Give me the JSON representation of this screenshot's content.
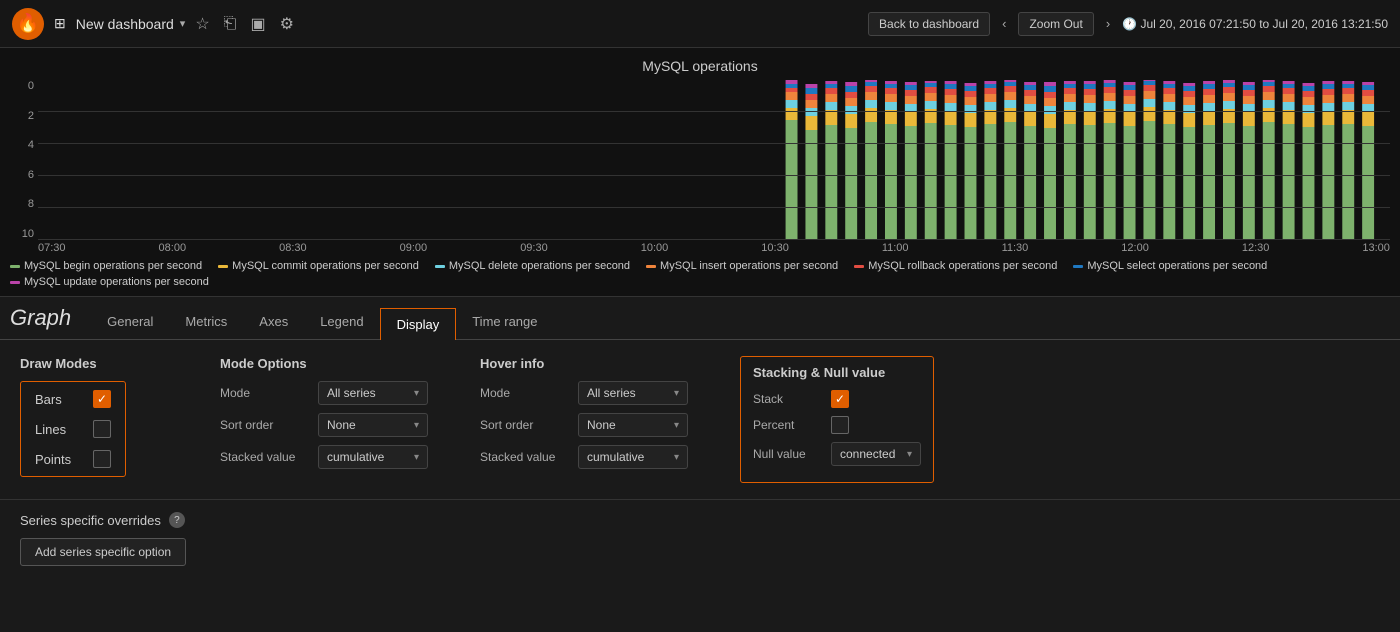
{
  "topnav": {
    "logo": "🔥",
    "dashboard_title": "New dashboard",
    "dropdown_arrow": "▾",
    "icons": {
      "star": "☆",
      "share": "⎘",
      "save": "💾",
      "settings": "⚙"
    },
    "back_btn": "Back to dashboard",
    "zoom_out_label": "Zoom Out",
    "time_range": "Jul 20, 2016 07:21:50 to Jul 20, 2016 13:21:50",
    "clock_icon": "🕐"
  },
  "chart": {
    "title": "MySQL operations",
    "y_axis": [
      "0",
      "2",
      "4",
      "6",
      "8",
      "10"
    ],
    "x_axis": [
      "07:30",
      "08:00",
      "08:30",
      "09:00",
      "09:30",
      "10:00",
      "10:30",
      "11:00",
      "11:30",
      "12:00",
      "12:30",
      "13:00"
    ],
    "legend": [
      {
        "label": "MySQL begin operations per second",
        "color": "#7eb26d"
      },
      {
        "label": "MySQL commit operations per second",
        "color": "#eab839"
      },
      {
        "label": "MySQL delete operations per second",
        "color": "#6ed0e0"
      },
      {
        "label": "MySQL insert operations per second",
        "color": "#ef843c"
      },
      {
        "label": "MySQL rollback operations per second",
        "color": "#e24d42"
      },
      {
        "label": "MySQL select operations per second",
        "color": "#1f78c1"
      },
      {
        "label": "MySQL update operations per second",
        "color": "#ba43a9"
      }
    ]
  },
  "panel": {
    "title": "Graph",
    "tabs": [
      "General",
      "Metrics",
      "Axes",
      "Legend",
      "Display",
      "Time range"
    ],
    "active_tab": "Display"
  },
  "display": {
    "draw_modes": {
      "title": "Draw Modes",
      "items": [
        {
          "label": "Bars",
          "checked": true
        },
        {
          "label": "Lines",
          "checked": false
        },
        {
          "label": "Points",
          "checked": false
        }
      ]
    },
    "mode_options": {
      "title": "Mode Options",
      "rows": [
        {
          "label": "Mode",
          "value": "All series"
        },
        {
          "label": "Sort order",
          "value": "None"
        },
        {
          "label": "Stacked value",
          "value": "cumulative"
        }
      ]
    },
    "hover_info": {
      "title": "Hover info",
      "rows": [
        {
          "label": "Mode",
          "value": "All series"
        },
        {
          "label": "Sort order",
          "value": "None"
        },
        {
          "label": "Stacked value",
          "value": "cumulative"
        }
      ]
    },
    "stacking": {
      "title": "Stacking & Null value",
      "rows": [
        {
          "label": "Stack",
          "checked": true,
          "type": "checkbox"
        },
        {
          "label": "Percent",
          "checked": false,
          "type": "checkbox"
        },
        {
          "label": "Null value",
          "value": "connected",
          "type": "select"
        }
      ]
    }
  },
  "series_overrides": {
    "title": "Series specific overrides",
    "add_btn": "Add series specific option"
  }
}
